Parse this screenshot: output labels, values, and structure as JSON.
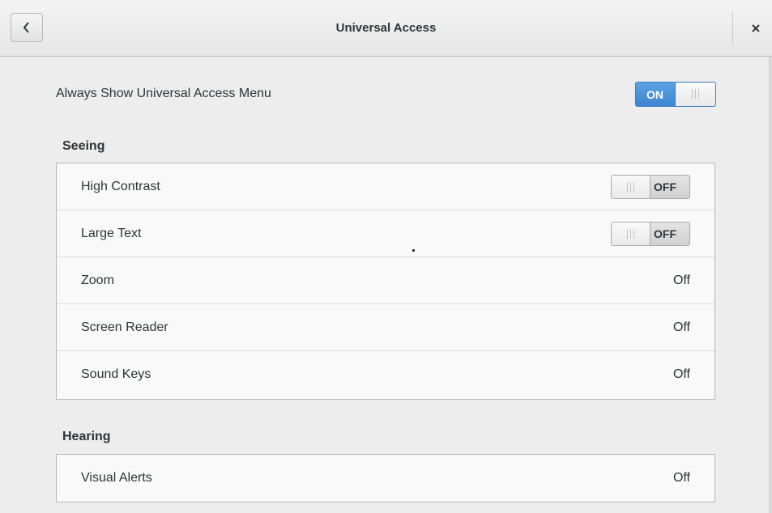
{
  "header": {
    "title": "Universal Access",
    "back_icon": "chevron-left-icon",
    "close_icon": "close-icon"
  },
  "always_show": {
    "label": "Always Show Universal Access Menu",
    "switch_state": "ON"
  },
  "seeing": {
    "heading": "Seeing",
    "rows": [
      {
        "label": "High Contrast",
        "switch_state": "OFF"
      },
      {
        "label": "Large Text",
        "switch_state": "OFF"
      },
      {
        "label": "Zoom",
        "value": "Off"
      },
      {
        "label": "Screen Reader",
        "value": "Off"
      },
      {
        "label": "Sound Keys",
        "value": "Off"
      }
    ]
  },
  "hearing": {
    "heading": "Hearing",
    "rows": [
      {
        "label": "Visual Alerts",
        "value": "Off"
      }
    ]
  },
  "colors": {
    "accent": "#4a90d9",
    "background": "#ededed",
    "list_background": "#f9f9f9",
    "text": "#2e3436"
  }
}
